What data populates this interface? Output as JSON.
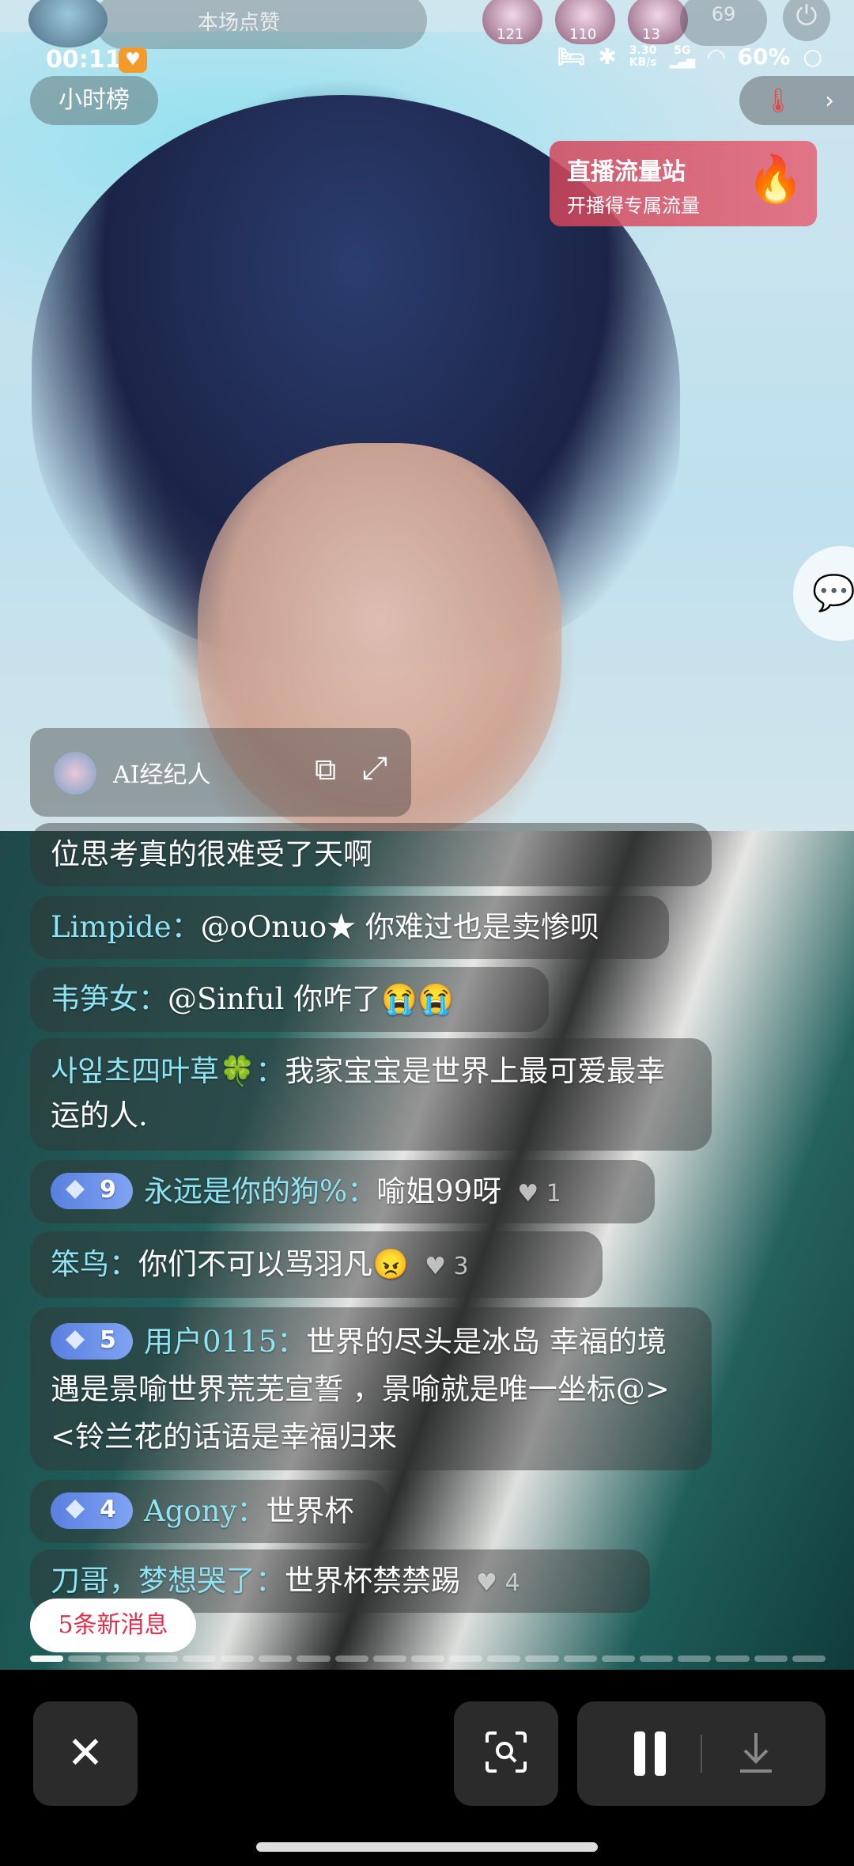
{
  "status_bar": {
    "time": "00:11",
    "net_speed": "3.30",
    "net_unit": "KB/s",
    "signal": "5G",
    "battery": "60%"
  },
  "top": {
    "room_subtitle": "本场点赞",
    "viewer_badges": [
      "121",
      "110",
      "13"
    ],
    "viewer_count": "69",
    "hour_rank_label": "小时榜"
  },
  "promo": {
    "title": "直播流量站",
    "subtitle": "开播得专属流量",
    "icon": "fire-icon"
  },
  "ai_card": {
    "label": "AI经纪人"
  },
  "comments": [
    {
      "name": "",
      "text": "位思考真的很难受了天啊",
      "badge": "",
      "likes": ""
    },
    {
      "name": "Limpide：",
      "text": "@oOnuo★ 你难过也是卖惨呗",
      "badge": "",
      "likes": ""
    },
    {
      "name": "韦笋女：",
      "text": "@Sinful 你咋了😭😭",
      "badge": "",
      "likes": ""
    },
    {
      "name": "사잎초四叶草🍀：",
      "text": "我家宝宝是世界上最可爱最幸运的人.",
      "badge": "",
      "likes": ""
    },
    {
      "name": "永远是你的狗%：",
      "text": "喻姐99呀",
      "badge": "9",
      "likes": "1"
    },
    {
      "name": "笨鸟：",
      "text": "你们不可以骂羽凡😠",
      "badge": "",
      "likes": "3"
    },
    {
      "name": "用户0115：",
      "text": "世界的尽头是冰岛 幸福的境遇是景喻世界荒芜宣誓 ，景喻就是唯一坐标@><铃兰花的话语是幸福归来",
      "badge": "5",
      "likes": ""
    },
    {
      "name": "Agony：",
      "text": "世界杯",
      "badge": "4",
      "likes": ""
    },
    {
      "name": "刀哥，梦想哭了：",
      "text": "世界杯禁禁踢",
      "badge": "",
      "likes": "4"
    }
  ],
  "new_messages_label": "5条新消息",
  "bottom_bar": {
    "close_icon": "close-icon",
    "scan_icon": "screenshot-scan-icon",
    "pause_icon": "pause-icon",
    "download_icon": "download-icon"
  },
  "colors": {
    "promo_bg": "#d8465a",
    "name_color": "#8ee4f4",
    "badge_blue": "#5a7fe0",
    "new_msg_text": "#e0304c"
  }
}
